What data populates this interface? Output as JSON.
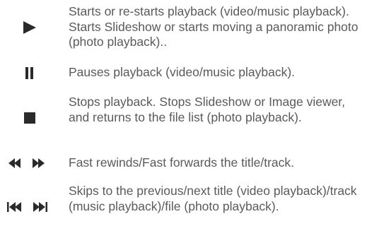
{
  "icon_color": "#2a2a2a",
  "text_color": "#5a5a5a",
  "rows": [
    {
      "icon": "play-icon",
      "description": "Starts or re-starts playback (video/music playback). Starts Slideshow or starts moving a panoramic photo (photo playback).."
    },
    {
      "icon": "pause-icon",
      "description": "Pauses playback (video/music playback)."
    },
    {
      "icon": "stop-icon",
      "description": "Stops playback. Stops Slideshow or Image viewer, and returns to the file list (photo playback)."
    },
    {
      "icon": "rewind-fast-forward-icon",
      "description": "Fast rewinds/Fast forwards the title/track."
    },
    {
      "icon": "skip-previous-next-icon",
      "description": "Skips to the previous/next title (video playback)/track (music playback)/file (photo playback)."
    }
  ]
}
